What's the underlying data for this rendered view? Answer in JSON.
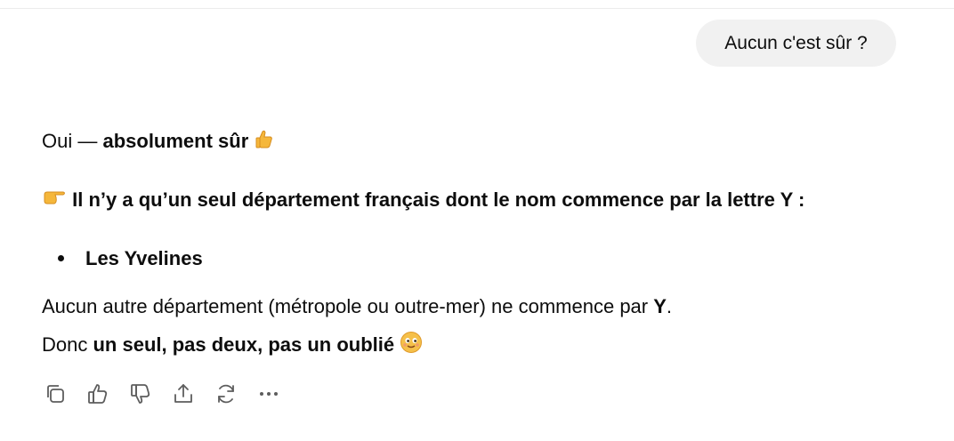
{
  "conversation": {
    "user_message": "Aucun c'est sûr ?",
    "assistant": {
      "line1_prefix": "Oui — ",
      "line1_bold": "absolument sûr",
      "line2_bold": "Il n’y a qu’un seul département français dont le nom commence par la lettre Y :",
      "list_item": "Les Yvelines",
      "line4_text": "Aucun autre département (métropole ou outre-mer) ne commence par ",
      "line4_bold": "Y",
      "line4_end": ".",
      "line5_prefix": "Donc ",
      "line5_bold": "un seul, pas deux, pas un oublié"
    }
  },
  "actions": {
    "icons": [
      "copy-icon",
      "thumbs-up-icon",
      "thumbs-down-icon",
      "share-icon",
      "regenerate-icon",
      "more-icon"
    ]
  },
  "colors": {
    "bubble_bg": "#f1f1f1",
    "text": "#0d0d0d",
    "icon": "#5d5d5d",
    "emoji": "#f5b73b"
  }
}
